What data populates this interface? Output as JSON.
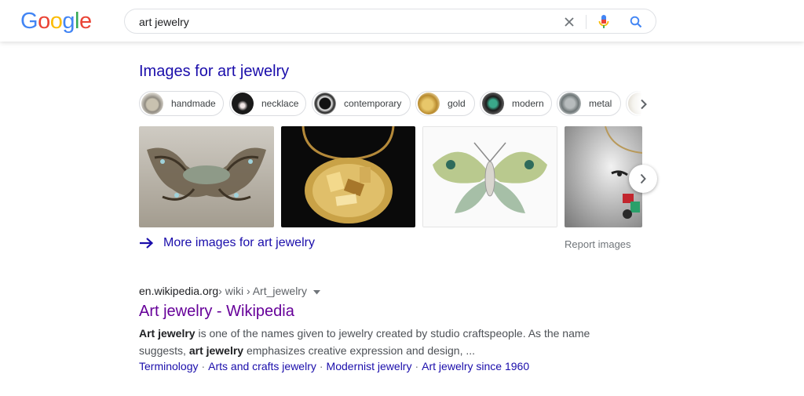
{
  "logo": {
    "letters": [
      "G",
      "o",
      "o",
      "g",
      "l",
      "e"
    ],
    "colors": [
      "#4285F4",
      "#EA4335",
      "#FBBC05",
      "#4285F4",
      "#34A853",
      "#EA4335"
    ]
  },
  "search": {
    "value": "art jewelry"
  },
  "images_section": {
    "title": "Images for art jewelry",
    "chips": [
      {
        "label": "handmade"
      },
      {
        "label": "necklace"
      },
      {
        "label": "contemporary"
      },
      {
        "label": "gold"
      },
      {
        "label": "modern"
      },
      {
        "label": "metal"
      }
    ],
    "more_link": "More images for art jewelry",
    "report": "Report images"
  },
  "result": {
    "domain": "en.wikipedia.org",
    "path": " › wiki › Art_jewelry",
    "title": "Art jewelry - Wikipedia",
    "snippet_line1_bold": "Art jewelry",
    "snippet_line1_rest": " is one of the names given to jewelry created by studio craftspeople. As the name",
    "snippet_line2_start": "suggests, ",
    "snippet_line2_bold": "art jewelry",
    "snippet_line2_rest": " emphasizes creative expression and design, ...",
    "sitelinks": [
      "Terminology",
      "Arts and crafts jewelry",
      "Modernist jewelry",
      "Art jewelry since 1960"
    ]
  },
  "colors": {
    "link": "#1a0dab",
    "visited": "#660099",
    "accent_blue": "#4285F4"
  }
}
